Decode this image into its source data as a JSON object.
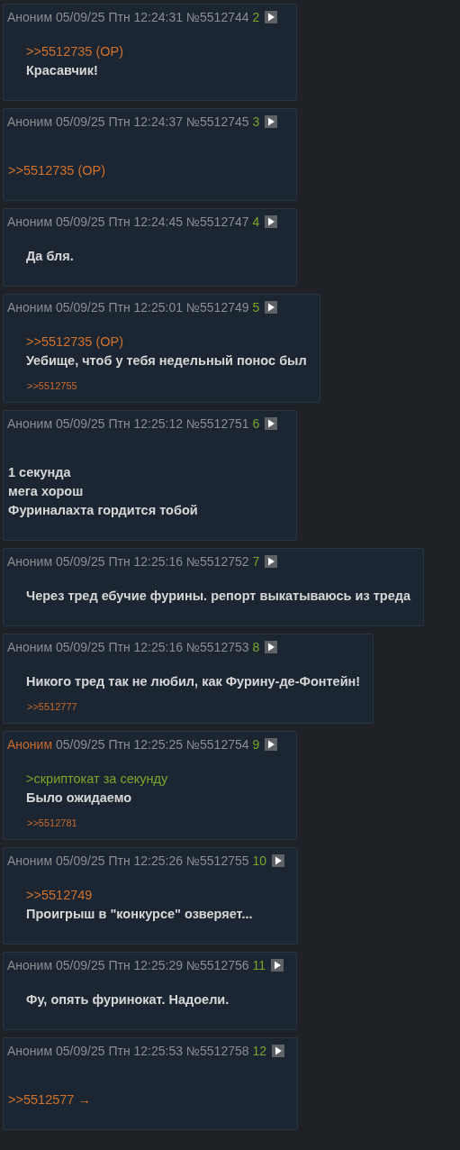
{
  "posts": [
    {
      "name": "Аноним",
      "name_highlighted": false,
      "date": "05/09/25 Птн 12:24:31",
      "number": "№5512744",
      "count": "2",
      "indented": true,
      "lines": [
        {
          "kind": "link",
          "text": ">>5512735 (OP)"
        },
        {
          "kind": "text",
          "text": "Красавчик!"
        }
      ]
    },
    {
      "name": "Аноним",
      "name_highlighted": false,
      "date": "05/09/25 Птн 12:24:37",
      "number": "№5512745",
      "count": "3",
      "indented": false,
      "lines": [
        {
          "kind": "link",
          "text": ">>5512735 (OP)"
        }
      ]
    },
    {
      "name": "Аноним",
      "name_highlighted": false,
      "date": "05/09/25 Птн 12:24:45",
      "number": "№5512747",
      "count": "4",
      "indented": true,
      "lines": [
        {
          "kind": "text",
          "text": "Да бля."
        }
      ]
    },
    {
      "name": "Аноним",
      "name_highlighted": false,
      "date": "05/09/25 Птн 12:25:01",
      "number": "№5512749",
      "count": "5",
      "indented": true,
      "lines": [
        {
          "kind": "link",
          "text": ">>5512735 (OP)"
        },
        {
          "kind": "text",
          "text": "Уебище, чтоб у тебя недельный понос был"
        }
      ],
      "backlinks": [
        ">>5512755"
      ]
    },
    {
      "name": "Аноним",
      "name_highlighted": false,
      "date": "05/09/25 Птн 12:25:12",
      "number": "№5512751",
      "count": "6",
      "indented": false,
      "lines": [
        {
          "kind": "text",
          "text": "1 секунда"
        },
        {
          "kind": "text",
          "text": "мега хорош"
        },
        {
          "kind": "text",
          "text": "Фуриналахта гордится тобой"
        }
      ]
    },
    {
      "name": "Аноним",
      "name_highlighted": false,
      "date": "05/09/25 Птн 12:25:16",
      "number": "№5512752",
      "count": "7",
      "indented": true,
      "lines": [
        {
          "kind": "text",
          "text": "Через тред ебучие фурины. репорт выкатываюсь из треда"
        }
      ]
    },
    {
      "name": "Аноним",
      "name_highlighted": false,
      "date": "05/09/25 Птн 12:25:16",
      "number": "№5512753",
      "count": "8",
      "indented": true,
      "lines": [
        {
          "kind": "text",
          "text": "Никого тред так не любил, как Фурину-де-Фонтейн!"
        }
      ],
      "backlinks": [
        ">>5512777"
      ]
    },
    {
      "name": "Аноним",
      "name_highlighted": true,
      "date": "05/09/25 Птн 12:25:25",
      "number": "№5512754",
      "count": "9",
      "indented": true,
      "lines": [
        {
          "kind": "quote",
          "text": ">скриптокат за секунду"
        },
        {
          "kind": "text",
          "text": "Было ожидаемо"
        }
      ],
      "backlinks": [
        ">>5512781"
      ]
    },
    {
      "name": "Аноним",
      "name_highlighted": false,
      "date": "05/09/25 Птн 12:25:26",
      "number": "№5512755",
      "count": "10",
      "indented": true,
      "lines": [
        {
          "kind": "link",
          "text": ">>5512749"
        },
        {
          "kind": "text",
          "text": "Проигрыш в \"конкурсе\" озверяет..."
        }
      ]
    },
    {
      "name": "Аноним",
      "name_highlighted": false,
      "date": "05/09/25 Птн 12:25:29",
      "number": "№5512756",
      "count": "11",
      "indented": true,
      "lines": [
        {
          "kind": "text",
          "text": "Фу, опять фуринокат. Надоели."
        }
      ]
    },
    {
      "name": "Аноним",
      "name_highlighted": false,
      "date": "05/09/25 Птн 12:25:53",
      "number": "№5512758",
      "count": "12",
      "indented": false,
      "lines": [
        {
          "kind": "link",
          "text": ">>5512577 →"
        }
      ]
    }
  ]
}
